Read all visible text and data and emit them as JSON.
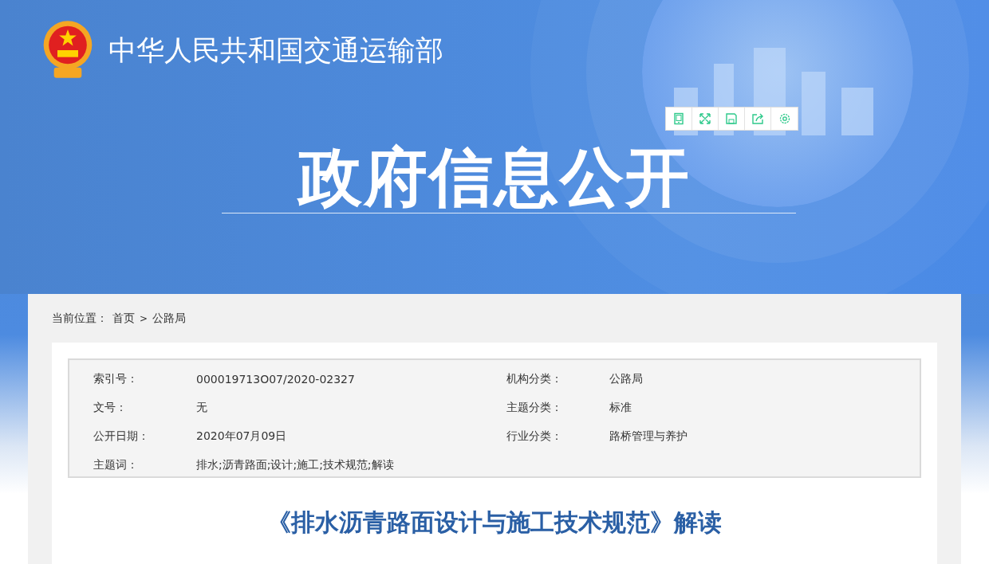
{
  "header": {
    "site_name": "中华人民共和国交通运输部",
    "section_title": "政府信息公开"
  },
  "breadcrumb": {
    "label": "当前位置：",
    "items": [
      "首页",
      "公路局"
    ],
    "separator": ">"
  },
  "info_table": {
    "rows": [
      {
        "left": {
          "label": "索引号：",
          "value": "000019713O07/2020-02327"
        },
        "right": {
          "label": "机构分类：",
          "value": "公路局"
        }
      },
      {
        "left": {
          "label": "文号：",
          "value": "无"
        },
        "right": {
          "label": "主题分类：",
          "value": "标准"
        }
      },
      {
        "left": {
          "label": "公开日期：",
          "value": "2020年07月09日"
        },
        "right": {
          "label": "行业分类：",
          "value": "路桥管理与养护"
        }
      },
      {
        "left": {
          "label": "主题词：",
          "value": "排水;沥青路面;设计;施工;技术规范;解读"
        }
      }
    ]
  },
  "article": {
    "title": "《排水沥青路面设计与施工技术规范》解读"
  }
}
